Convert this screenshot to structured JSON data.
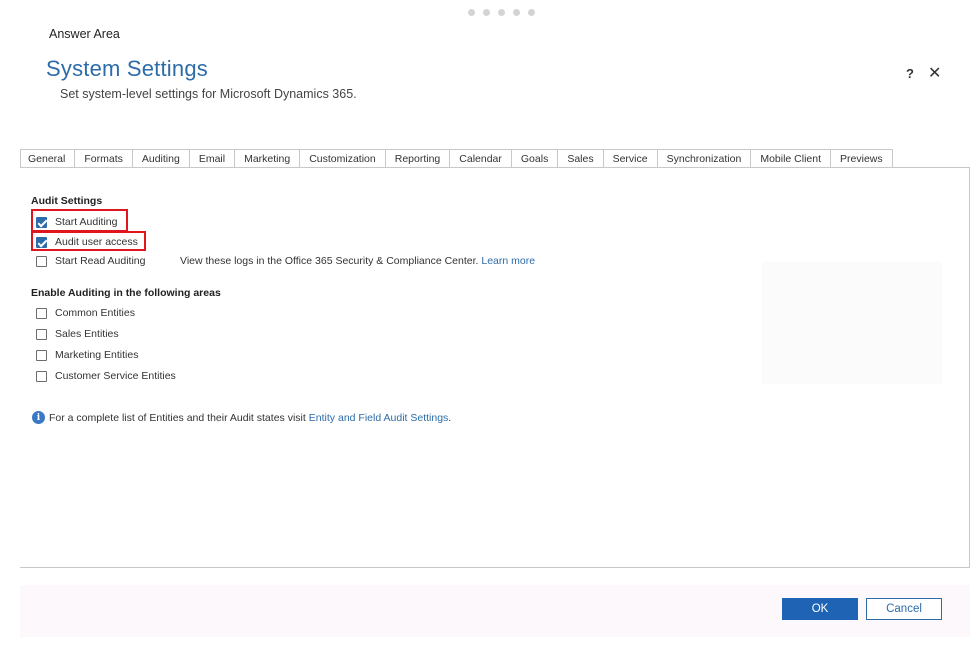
{
  "header": {
    "answer_area": "Answer Area",
    "title": "System Settings",
    "subtitle": "Set system-level settings for Microsoft Dynamics 365.",
    "help_glyph": "?",
    "close_glyph": "✕"
  },
  "tabs": [
    {
      "label": "General"
    },
    {
      "label": "Formats"
    },
    {
      "label": "Auditing",
      "active": true
    },
    {
      "label": "Email"
    },
    {
      "label": "Marketing"
    },
    {
      "label": "Customization"
    },
    {
      "label": "Reporting"
    },
    {
      "label": "Calendar"
    },
    {
      "label": "Goals"
    },
    {
      "label": "Sales"
    },
    {
      "label": "Service"
    },
    {
      "label": "Synchronization"
    },
    {
      "label": "Mobile Client"
    },
    {
      "label": "Previews"
    }
  ],
  "audit_settings": {
    "heading": "Audit Settings",
    "start_auditing": {
      "label": "Start Auditing",
      "checked": true
    },
    "audit_user_access": {
      "label": "Audit user access",
      "checked": true
    },
    "start_read_auditing": {
      "label": "Start Read Auditing",
      "checked": false
    },
    "read_note": "View these logs in the Office 365 Security & Compliance Center.",
    "learn_more": "Learn more"
  },
  "enable_areas": {
    "heading": "Enable Auditing in the following areas",
    "items": [
      {
        "label": "Common Entities",
        "checked": false
      },
      {
        "label": "Sales Entities",
        "checked": false
      },
      {
        "label": "Marketing Entities",
        "checked": false
      },
      {
        "label": "Customer Service Entities",
        "checked": false
      }
    ]
  },
  "info": {
    "icon_glyph": "i",
    "text": "For a complete list of Entities and their Audit states visit",
    "link": "Entity and Field Audit Settings",
    "tail": "."
  },
  "footer": {
    "ok": "OK",
    "cancel": "Cancel"
  },
  "colors": {
    "accent": "#2d6ca8",
    "highlight": "#e0151d",
    "ok_button": "#1f64b4"
  }
}
